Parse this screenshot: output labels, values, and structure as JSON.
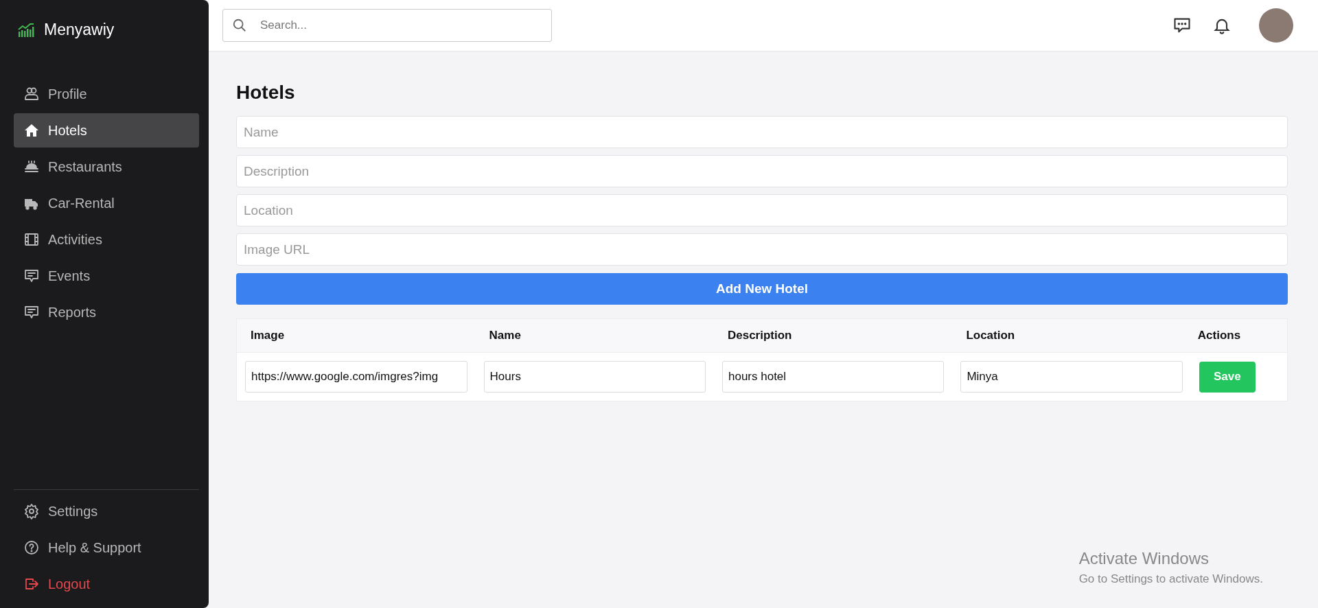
{
  "brand": {
    "name": "Menyawiy"
  },
  "sidebar": {
    "items": [
      {
        "label": "Profile",
        "selected": false
      },
      {
        "label": "Hotels",
        "selected": true
      },
      {
        "label": "Restaurants",
        "selected": false
      },
      {
        "label": "Car-Rental",
        "selected": false
      },
      {
        "label": "Activities",
        "selected": false
      },
      {
        "label": "Events",
        "selected": false
      },
      {
        "label": "Reports",
        "selected": false
      }
    ],
    "bottom_items": [
      {
        "label": "Settings",
        "kind": "normal"
      },
      {
        "label": "Help & Support",
        "kind": "normal"
      },
      {
        "label": "Logout",
        "kind": "danger"
      }
    ]
  },
  "topbar": {
    "search": {
      "placeholder": "Search..."
    }
  },
  "page": {
    "title": "Hotels",
    "form": {
      "fields": [
        {
          "placeholder": "Name"
        },
        {
          "placeholder": "Description"
        },
        {
          "placeholder": "Location"
        },
        {
          "placeholder": "Image URL"
        }
      ],
      "submit": "Add New Hotel"
    },
    "table": {
      "columns": [
        "Image",
        "Name",
        "Description",
        "Location",
        "Actions"
      ],
      "rows": [
        {
          "cells": [
            "https://www.google.com/imgres?img",
            "Hours",
            "hours hotel",
            "Minya"
          ],
          "action": "Save"
        }
      ]
    }
  },
  "os_notice": {
    "title": "Activate Windows",
    "text": "Go to Settings to activate Windows."
  }
}
